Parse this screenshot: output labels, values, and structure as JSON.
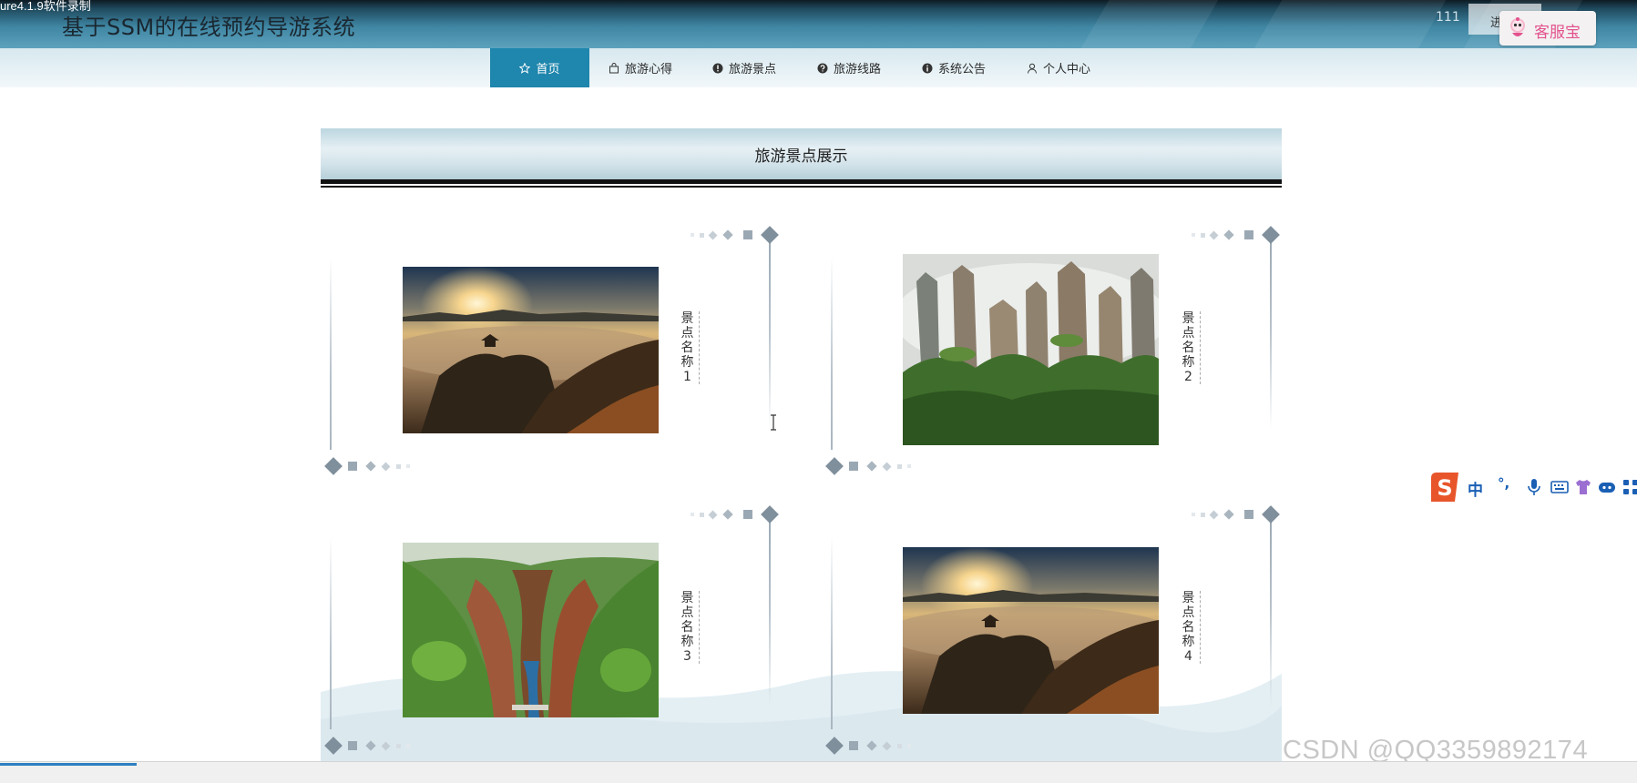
{
  "recorder": {
    "label": "ure4.1.9软件录制"
  },
  "header": {
    "title": "基于SSM的在线预约导游系统",
    "user_count": "111",
    "login_label": "进",
    "service_label": "客服宝",
    "colors": {
      "header_top": "#0d1b24",
      "header_bottom": "#5da2bd"
    }
  },
  "nav": {
    "active_color": "#1f86ad",
    "items": [
      {
        "label": "首页",
        "icon": "star-icon",
        "active": true
      },
      {
        "label": "旅游心得",
        "icon": "bag-icon"
      },
      {
        "label": "旅游景点",
        "icon": "info-circle-icon"
      },
      {
        "label": "旅游线路",
        "icon": "question-circle-icon"
      },
      {
        "label": "系统公告",
        "icon": "info-icon"
      },
      {
        "label": "个人中心",
        "icon": "user-icon"
      }
    ]
  },
  "section": {
    "title": "旅游景点展示"
  },
  "cards": [
    {
      "name": "景点名称1",
      "image": "sea-of-clouds-sunrise-pavilion"
    },
    {
      "name": "景点名称2",
      "image": "karst-stone-pillars-in-mist"
    },
    {
      "name": "景点名称3",
      "image": "green-canyon-with-river"
    },
    {
      "name": "景点名称4",
      "image": "sea-of-clouds-sunrise-pavilion"
    }
  ],
  "ime": {
    "logo": "sogou-s-icon",
    "mode": "中",
    "punct": "°,"
  },
  "watermark": "CSDN @QQ3359892174"
}
